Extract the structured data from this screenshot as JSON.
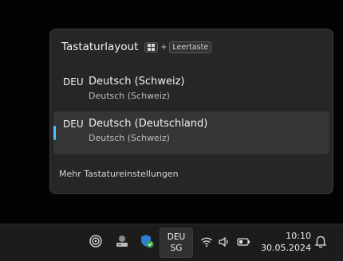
{
  "flyout": {
    "title": "Tastaturlayout",
    "shortcut": {
      "icon": "windows-logo-icon",
      "plus": "+",
      "key_label": "Leertaste"
    },
    "layouts": [
      {
        "code": "DEU",
        "name": "Deutsch (Schweiz)",
        "keyboard": "Deutsch (Schweiz)",
        "selected": false
      },
      {
        "code": "DEU",
        "name": "Deutsch (Deutschland)",
        "keyboard": "Deutsch (Schweiz)",
        "selected": true
      }
    ],
    "more_settings": "Mehr Tastatureinstellungen"
  },
  "taskbar": {
    "tray_icons": [
      "copilot-icon",
      "network-drive-icon",
      "windows-security-icon"
    ],
    "language": {
      "line1": "DEU",
      "line2": "SG"
    },
    "status_icons": [
      "wifi-icon",
      "speaker-icon",
      "battery-icon"
    ],
    "clock": {
      "time": "10:10",
      "date": "30.05.2024"
    },
    "notification_icon": "bell-icon"
  },
  "colors": {
    "accent": "#4cc2ff",
    "flyout_bg": "#262626",
    "selected_item_bg": "#353535",
    "taskbar_bg": "#1c1c1c",
    "desktop_bg": "#030303"
  }
}
